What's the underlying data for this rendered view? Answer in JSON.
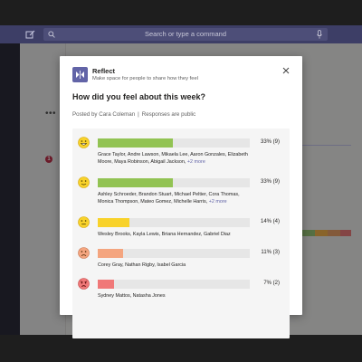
{
  "background": {
    "search_placeholder": "Search or type a command",
    "notification_count": "1",
    "more_label": "•••",
    "strip_colors": [
      "#9cca7a",
      "#f9b64d",
      "#eea46b",
      "#f17e7e"
    ],
    "compose_icons": [
      "format-icon",
      "attach-icon",
      "emoji-icon",
      "giphy-icon",
      "sticker-icon",
      "meet-icon",
      "more-icon"
    ]
  },
  "dialog": {
    "app_name": "Reflect",
    "app_description": "Make space for people to share how they feel",
    "question": "How did you feel about this week?",
    "posted_by": "Posted by Cara Coleman",
    "separator": "|",
    "visibility": "Responses are public",
    "results": [
      {
        "emoji": "grinning-face-icon",
        "fraction": 0.33,
        "bar_color": "#92c353",
        "percent_label": "33% (9)",
        "names": "Grace Taylor, Andre Lawson, Mikaela Lee, Aaron Gonzales, Elizabeth Moore, Maya Robinson, Abigail Jackson,",
        "more": "+2 more"
      },
      {
        "emoji": "smiling-face-icon",
        "fraction": 0.33,
        "bar_color": "#92c353",
        "percent_label": "33% (9)",
        "names": "Ashley Schroeder, Brandon Stuart, Michael Peltier, Cora Thomas, Monica Thompson, Mateo Gomez, Michelle Harris,",
        "more": "+2 more"
      },
      {
        "emoji": "neutral-face-icon",
        "fraction": 0.14,
        "bar_color": "#f8d22a",
        "percent_label": "14% (4)",
        "names": "Wesley Brooks, Kayla Lewis, Briana Hernandez, Gabriel Diaz",
        "more": ""
      },
      {
        "emoji": "frowning-face-icon",
        "fraction": 0.11,
        "bar_color": "#f4a57f",
        "percent_label": "11% (3)",
        "names": "Corey Gray, Nathan Rigby, Isabel Garcia",
        "more": ""
      },
      {
        "emoji": "angry-face-icon",
        "fraction": 0.07,
        "bar_color": "#f07878",
        "percent_label": "7% (2)",
        "names": "Sydney Mattos, Natasha Jones",
        "more": ""
      }
    ]
  }
}
